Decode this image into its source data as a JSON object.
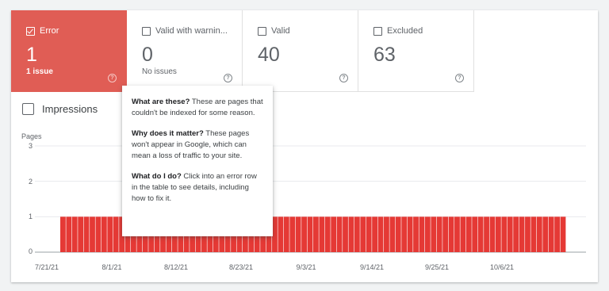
{
  "tiles": [
    {
      "label": "Error",
      "count": "1",
      "sub": "1 issue",
      "selected": true
    },
    {
      "label": "Valid with warnin...",
      "count": "0",
      "sub": "No issues",
      "selected": false
    },
    {
      "label": "Valid",
      "count": "40",
      "sub": "",
      "selected": false
    },
    {
      "label": "Excluded",
      "count": "63",
      "sub": "",
      "selected": false
    }
  ],
  "impressions_label": "Impressions",
  "tooltip": {
    "q1": "What are these?",
    "a1": " These are pages that couldn't be indexed for some reason.",
    "q2": "Why does it matter?",
    "a2": " These pages won't appear in Google, which can mean a loss of traffic to your site.",
    "q3": "What do I do?",
    "a3": " Click into an error row in the table to see details, including how to fix it."
  },
  "colors": {
    "error": "#e05d55",
    "bar": "#e53935"
  },
  "chart_data": {
    "type": "bar",
    "ylabel": "Pages",
    "ylim": [
      0,
      3
    ],
    "yticks": [
      "0",
      "1",
      "2",
      "3"
    ],
    "xticks": [
      "7/21/21",
      "8/1/21",
      "8/12/21",
      "8/23/21",
      "9/3/21",
      "9/14/21",
      "9/25/21",
      "10/6/21"
    ],
    "series": [
      {
        "values": [
          1,
          1,
          1,
          1,
          1,
          1,
          1,
          1,
          1,
          1,
          1,
          1,
          1,
          1,
          1,
          1,
          1,
          1,
          1,
          1,
          1,
          1,
          1,
          1,
          1,
          1,
          1,
          1,
          1,
          1,
          1,
          1,
          1,
          1,
          1,
          1,
          1,
          1,
          1,
          1,
          1,
          1,
          1,
          1,
          1,
          1,
          1,
          1,
          1,
          1,
          1,
          1,
          1,
          1,
          1,
          1,
          1,
          1,
          1,
          1,
          1,
          1,
          1,
          1,
          1,
          1,
          1,
          1,
          1,
          1,
          1,
          1,
          1,
          1,
          1,
          1,
          1,
          1,
          1,
          1,
          1,
          1,
          1,
          1,
          1,
          1
        ]
      }
    ],
    "grid": true
  }
}
